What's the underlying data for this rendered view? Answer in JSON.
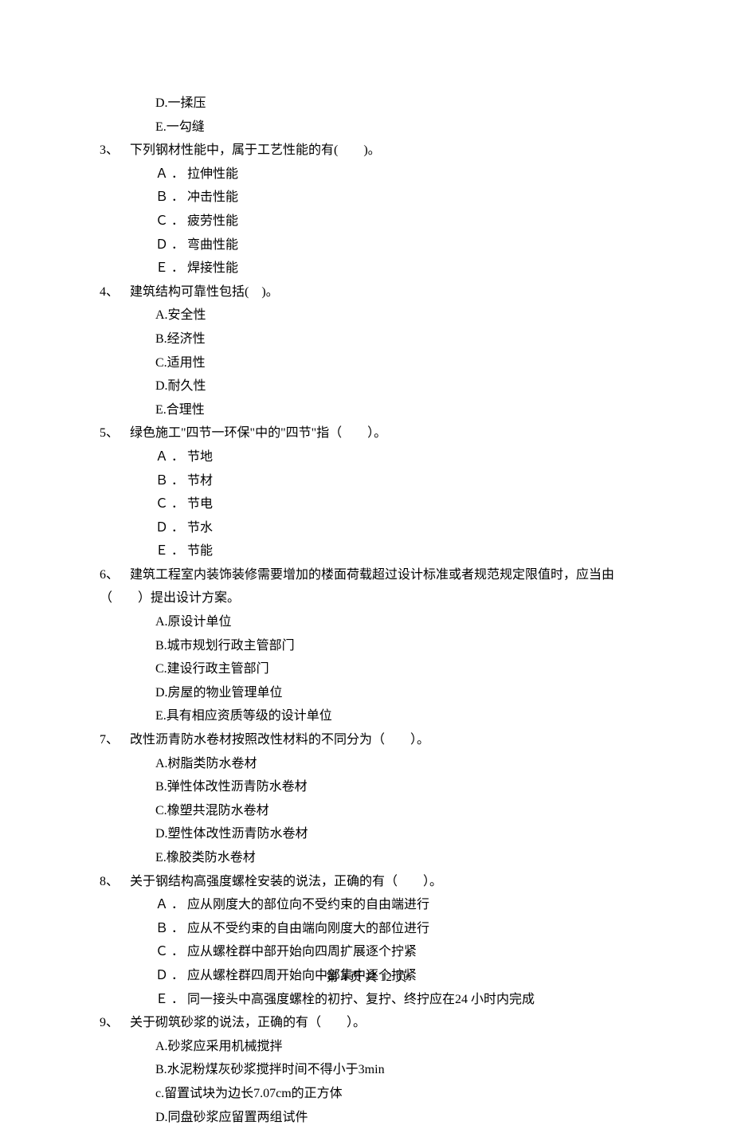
{
  "continued_options": [
    "D.一揉压",
    "E.一勾缝"
  ],
  "questions": [
    {
      "number": "3、",
      "stem": "下列钢材性能中，属于工艺性能的有(　　)。",
      "options": [
        "Ａ ． 拉伸性能",
        "Ｂ ． 冲击性能",
        "Ｃ ． 疲劳性能",
        "Ｄ ． 弯曲性能",
        "Ｅ ． 焊接性能"
      ]
    },
    {
      "number": "4、",
      "stem": "建筑结构可靠性包括(　)。",
      "options": [
        "A.安全性",
        "B.经济性",
        "C.适用性",
        "D.耐久性",
        "E.合理性"
      ]
    },
    {
      "number": "5、",
      "stem": "绿色施工\"四节一环保\"中的\"四节\"指（　　）。",
      "options": [
        "Ａ ． 节地",
        "Ｂ ． 节材",
        "Ｃ ． 节电",
        "Ｄ ． 节水",
        "Ｅ ． 节能"
      ]
    },
    {
      "number": "6、",
      "stem": "建筑工程室内装饰装修需要增加的楼面荷载超过设计标准或者规范规定限值时，应当由",
      "stem_line2": "（　　）提出设计方案。",
      "options": [
        "A.原设计单位",
        "B.城市规划行政主管部门",
        "C.建设行政主管部门",
        "D.房屋的物业管理单位",
        "E.具有相应资质等级的设计单位"
      ]
    },
    {
      "number": "7、",
      "stem": "改性沥青防水卷材按照改性材料的不同分为（　　）。",
      "options": [
        "A.树脂类防水卷材",
        "B.弹性体改性沥青防水卷材",
        "C.橡塑共混防水卷材",
        "D.塑性体改性沥青防水卷材",
        "E.橡胶类防水卷材"
      ]
    },
    {
      "number": "8、",
      "stem": "关于钢结构高强度螺栓安装的说法，正确的有（　　）。",
      "options": [
        "Ａ ． 应从刚度大的部位向不受约束的自由端进行",
        "Ｂ ． 应从不受约束的自由端向刚度大的部位进行",
        "Ｃ ． 应从螺栓群中部开始向四周扩展逐个拧紧",
        "Ｄ ． 应从螺栓群四周开始向中部集中逐个拧紧",
        "Ｅ ． 同一接头中高强度螺栓的初拧、复拧、终拧应在24 小时内完成"
      ]
    },
    {
      "number": "9、",
      "stem": "关于砌筑砂浆的说法，正确的有（　　）。",
      "options": [
        "A.砂浆应采用机械搅拌",
        "B.水泥粉煤灰砂浆搅拌时间不得小于3min",
        "c.留置试块为边长7.07cm的正方体",
        "D.同盘砂浆应留置两组试件"
      ]
    }
  ],
  "footer": "第 4 页 共 12 页"
}
